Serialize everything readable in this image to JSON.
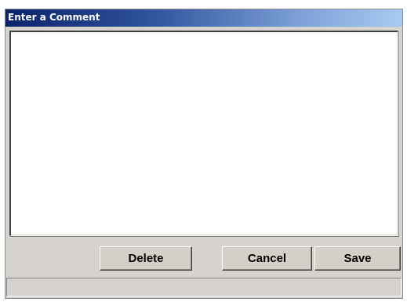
{
  "window": {
    "title": "Enter a Comment"
  },
  "comment": {
    "value": "",
    "placeholder": ""
  },
  "buttons": {
    "delete_label": "Delete",
    "cancel_label": "Cancel",
    "save_label": "Save"
  },
  "status": {
    "text": ""
  },
  "colors": {
    "titlebar_start": "#0a246a",
    "titlebar_end": "#a6caf0",
    "dialog_background": "#d6d3ce",
    "text_area_background": "#ffffff"
  }
}
